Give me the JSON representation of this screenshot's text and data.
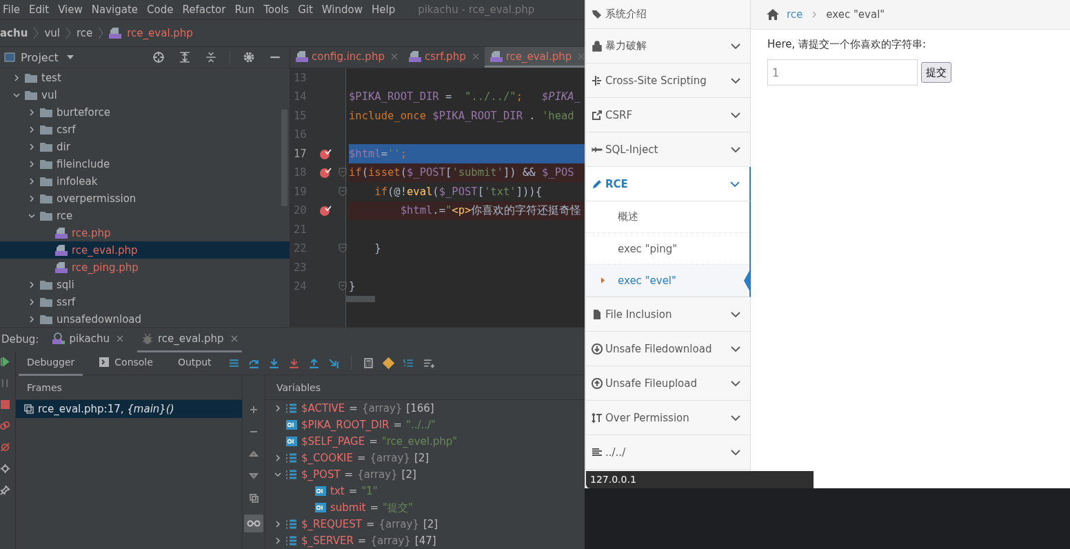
{
  "menu_bar": {
    "items": [
      "File",
      "Edit",
      "View",
      "Navigate",
      "Code",
      "Refactor",
      "Run",
      "Tools",
      "Git",
      "Window",
      "Help"
    ],
    "title": "pikachu - rce_eval.php"
  },
  "breadcrumb": [
    {
      "label": "achu",
      "kind": "project"
    },
    {
      "label": "vul",
      "kind": "folder"
    },
    {
      "label": "rce",
      "kind": "folder"
    },
    {
      "label": "rce_eval.php",
      "kind": "file"
    }
  ],
  "project_panel": {
    "title": "Project",
    "tree": [
      {
        "label": "test",
        "kind": "folder",
        "expanded": false,
        "selected": false
      },
      {
        "label": "vul",
        "kind": "folder",
        "expanded": true,
        "selected": false,
        "children": [
          {
            "label": "burteforce",
            "kind": "folder",
            "expanded": false,
            "selected": false
          },
          {
            "label": "csrf",
            "kind": "folder",
            "expanded": false,
            "selected": false
          },
          {
            "label": "dir",
            "kind": "folder",
            "expanded": false,
            "selected": false
          },
          {
            "label": "fileinclude",
            "kind": "folder",
            "expanded": false,
            "selected": false
          },
          {
            "label": "infoleak",
            "kind": "folder",
            "expanded": false,
            "selected": false
          },
          {
            "label": "overpermission",
            "kind": "folder",
            "expanded": false,
            "selected": false
          },
          {
            "label": "rce",
            "kind": "folder",
            "expanded": true,
            "selected": false,
            "children": [
              {
                "label": "rce.php",
                "kind": "php",
                "selected": false
              },
              {
                "label": "rce_eval.php",
                "kind": "php",
                "selected": true
              },
              {
                "label": "rce_ping.php",
                "kind": "php",
                "selected": false
              }
            ]
          },
          {
            "label": "sqli",
            "kind": "folder",
            "expanded": false,
            "selected": false
          },
          {
            "label": "ssrf",
            "kind": "folder",
            "expanded": false,
            "selected": false
          },
          {
            "label": "unsafedownload",
            "kind": "folder",
            "expanded": false,
            "selected": false
          }
        ]
      }
    ]
  },
  "editor": {
    "tabs": [
      {
        "label": "config.inc.php",
        "selected": false
      },
      {
        "label": "csrf.php",
        "selected": false
      },
      {
        "label": "rce_eval.php",
        "selected": true
      }
    ],
    "lines": [
      {
        "number": "13",
        "breakpoint": false,
        "fold": false,
        "current": false
      },
      {
        "number": "14",
        "breakpoint": false,
        "fold": false,
        "current": false,
        "tokens": [
          {
            "kind": "var",
            "text": "$PIKA_ROOT_DIR"
          },
          {
            "kind": "plain",
            "text": " =  "
          },
          {
            "kind": "str",
            "text": "\"../../\""
          },
          {
            "kind": "kw",
            "text": ";"
          },
          {
            "kind": "ivar",
            "text": "   $PIKA_"
          }
        ]
      },
      {
        "number": "15",
        "breakpoint": false,
        "fold": false,
        "current": false,
        "tokens": [
          {
            "kind": "kw",
            "text": "include_once"
          },
          {
            "kind": "var",
            "text": " $PIKA_ROOT_DIR"
          },
          {
            "kind": "plain",
            "text": " . "
          },
          {
            "kind": "str",
            "text": "'head"
          }
        ]
      },
      {
        "number": "16",
        "breakpoint": false,
        "fold": false,
        "current": false
      },
      {
        "number": "17",
        "breakpoint": true,
        "fold": false,
        "current": true,
        "tokens": [
          {
            "kind": "var",
            "text": "$html"
          },
          {
            "kind": "plain",
            "text": "="
          },
          {
            "kind": "str",
            "text": "''"
          },
          {
            "kind": "kw",
            "text": ";"
          }
        ]
      },
      {
        "number": "18",
        "breakpoint": true,
        "fold": true,
        "current": false,
        "tokens": [
          {
            "kind": "kw",
            "text": "if"
          },
          {
            "kind": "plain",
            "text": "("
          },
          {
            "kind": "kw",
            "text": "isset"
          },
          {
            "kind": "plain",
            "text": "("
          },
          {
            "kind": "var",
            "text": "$_POST"
          },
          {
            "kind": "plain",
            "text": "["
          },
          {
            "kind": "str",
            "text": "'submit'"
          },
          {
            "kind": "plain",
            "text": "]) && "
          },
          {
            "kind": "var",
            "text": "$_POS"
          }
        ]
      },
      {
        "number": "19",
        "breakpoint": false,
        "fold": true,
        "current": false,
        "tokens": [
          {
            "kind": "kw",
            "text": "    if"
          },
          {
            "kind": "plain",
            "text": "(@!"
          },
          {
            "kind": "fn",
            "text": "eval"
          },
          {
            "kind": "plain",
            "text": "("
          },
          {
            "kind": "var",
            "text": "$_POST"
          },
          {
            "kind": "plain",
            "text": "["
          },
          {
            "kind": "str",
            "text": "'txt'"
          },
          {
            "kind": "plain",
            "text": "])){"
          }
        ]
      },
      {
        "number": "20",
        "breakpoint": true,
        "fold": false,
        "current": false,
        "tokens": [
          {
            "kind": "var",
            "text": "        $html"
          },
          {
            "kind": "plain",
            "text": ".="
          },
          {
            "kind": "str",
            "text": "\""
          },
          {
            "kind": "fn",
            "text": "<p>"
          },
          {
            "kind": "plain",
            "text": "你喜欢的字符还挺奇怪"
          }
        ]
      },
      {
        "number": "21",
        "breakpoint": false,
        "fold": false,
        "current": false
      },
      {
        "number": "22",
        "breakpoint": false,
        "fold": true,
        "current": false,
        "tokens": [
          {
            "kind": "plain",
            "text": "    }"
          }
        ]
      },
      {
        "number": "23",
        "breakpoint": false,
        "fold": false,
        "current": false
      },
      {
        "number": "24",
        "breakpoint": false,
        "fold": true,
        "current": false,
        "tokens": [
          {
            "kind": "plain",
            "text": "}"
          }
        ]
      }
    ]
  },
  "debug": {
    "label": "Debug:",
    "sessions": [
      {
        "label": "pikachu",
        "kind": "php",
        "selected": false
      },
      {
        "label": "rce_eval.php",
        "kind": "bug",
        "selected": true
      }
    ],
    "tabs": [
      {
        "label": "Debugger",
        "kind": "plain",
        "selected": true
      },
      {
        "label": "Console",
        "kind": "console",
        "selected": false
      },
      {
        "label": "Output",
        "kind": "plain",
        "selected": false
      }
    ],
    "frames_title": "Frames",
    "variables_title": "Variables",
    "frames": [
      {
        "text": "rce_eval.php:17, *{main}()*",
        "selected": true
      }
    ],
    "variables": [
      {
        "name": "$ACTIVE",
        "sign": "=",
        "type": "{array}",
        "value": "[166]",
        "kind": "array",
        "expanded": false
      },
      {
        "name": "$PIKA_ROOT_DIR",
        "sign": "=",
        "value": "\"../../\"",
        "kind": "string"
      },
      {
        "name": "$SELF_PAGE",
        "sign": "=",
        "value": "\"rce_evel.php\"",
        "kind": "string"
      },
      {
        "name": "$_COOKIE",
        "sign": "=",
        "type": "{array}",
        "value": "[2]",
        "kind": "array",
        "expanded": false
      },
      {
        "name": "$_POST",
        "sign": "=",
        "type": "{array}",
        "value": "[2]",
        "kind": "array",
        "expanded": true,
        "children": [
          {
            "name": "txt",
            "sign": "=",
            "value": "\"1\"",
            "kind": "string"
          },
          {
            "name": "submit",
            "sign": "=",
            "value": "\"提交\"",
            "kind": "string"
          }
        ]
      },
      {
        "name": "$_REQUEST",
        "sign": "=",
        "type": "{array}",
        "value": "[2]",
        "kind": "array",
        "expanded": false
      },
      {
        "name": "$_SERVER",
        "sign": "=",
        "type": "{array}",
        "value": "[47]",
        "kind": "array",
        "expanded": false
      }
    ]
  },
  "browser": {
    "sidebar": [
      {
        "label": "系统介绍",
        "kind": "tags",
        "chevron": false,
        "selected": false
      },
      {
        "label": "暴力破解",
        "kind": "lock",
        "chevron": true,
        "selected": false
      },
      {
        "label": "Cross-Site Scripting",
        "kind": "xss",
        "chevron": true,
        "selected": false
      },
      {
        "label": "CSRF",
        "kind": "share",
        "chevron": true,
        "selected": false
      },
      {
        "label": "SQL-Inject",
        "kind": "plane",
        "chevron": true,
        "selected": false
      },
      {
        "label": "RCE",
        "kind": "pencil",
        "chevron": true,
        "selected": true,
        "children": [
          {
            "label": "概述",
            "selected": false
          },
          {
            "label": "exec \"ping\"",
            "selected": false
          },
          {
            "label": "exec \"evel\"",
            "selected": true
          }
        ]
      },
      {
        "label": "File Inclusion",
        "kind": "file",
        "chevron": true,
        "selected": false
      },
      {
        "label": "Unsafe Filedownload",
        "kind": "download",
        "chevron": true,
        "selected": false
      },
      {
        "label": "Unsafe Fileupload",
        "kind": "upload",
        "chevron": true,
        "selected": false
      },
      {
        "label": "Over Permission",
        "kind": "text-height",
        "chevron": true,
        "selected": false
      },
      {
        "label": "../../",
        "kind": "align",
        "chevron": true,
        "selected": false
      }
    ],
    "breadcrumb": {
      "link": "rce",
      "current": "exec \"eval\""
    },
    "prompt": "Here, 请提交一个你喜欢的字符串:",
    "input_value": "1",
    "submit": "提交",
    "status": "127.0.0.1"
  }
}
